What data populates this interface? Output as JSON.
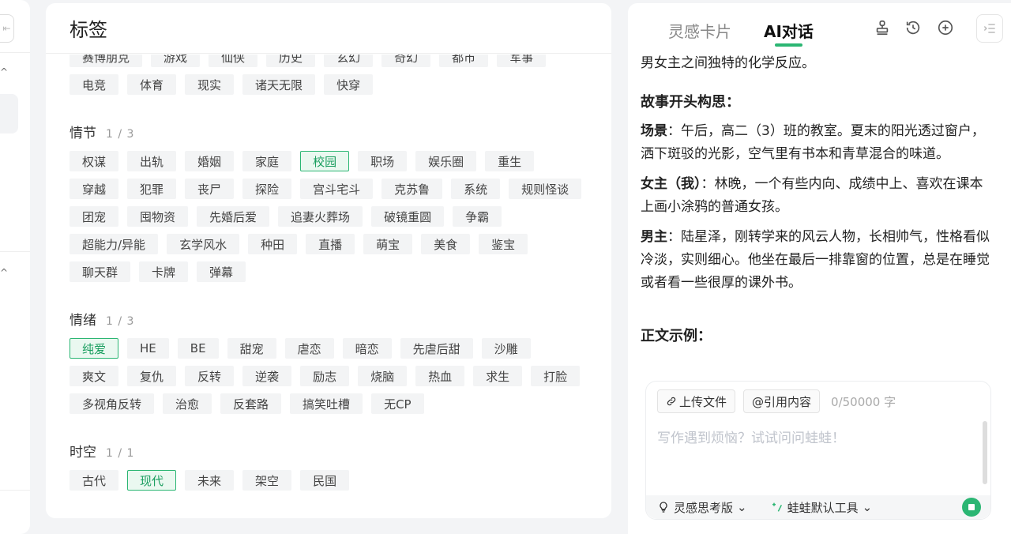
{
  "tag_panel": {
    "title": "标签",
    "sections": [
      {
        "tags": [
          "赛博朋克",
          "游戏",
          "仙侠",
          "历史",
          "玄幻",
          "奇幻",
          "都市",
          "军事",
          "电竞",
          "体育",
          "现实",
          "诸天无限",
          "快穿"
        ],
        "selected": []
      },
      {
        "title": "情节",
        "count": "1 / 3",
        "tags": [
          "权谋",
          "出轨",
          "婚姻",
          "家庭",
          "校园",
          "职场",
          "娱乐圈",
          "重生",
          "穿越",
          "犯罪",
          "丧尸",
          "探险",
          "宫斗宅斗",
          "克苏鲁",
          "系统",
          "规则怪谈",
          "团宠",
          "囤物资",
          "先婚后爱",
          "追妻火葬场",
          "破镜重圆",
          "争霸",
          "超能力/异能",
          "玄学风水",
          "种田",
          "直播",
          "萌宝",
          "美食",
          "鉴宝",
          "聊天群",
          "卡牌",
          "弹幕"
        ],
        "selected": [
          "校园"
        ]
      },
      {
        "title": "情绪",
        "count": "1 / 3",
        "tags": [
          "纯爱",
          "HE",
          "BE",
          "甜宠",
          "虐恋",
          "暗恋",
          "先虐后甜",
          "沙雕",
          "爽文",
          "复仇",
          "反转",
          "逆袭",
          "励志",
          "烧脑",
          "热血",
          "求生",
          "打脸",
          "多视角反转",
          "治愈",
          "反套路",
          "搞笑吐槽",
          "无CP"
        ],
        "selected": [
          "纯爱"
        ]
      },
      {
        "title": "时空",
        "count": "1 / 1",
        "tags": [
          "古代",
          "现代",
          "未来",
          "架空",
          "民国"
        ],
        "selected": [
          "现代"
        ]
      }
    ]
  },
  "chat_panel": {
    "tabs": [
      {
        "label": "灵感卡片",
        "active": false
      },
      {
        "label": "AI对话",
        "active": true
      }
    ],
    "header_icons": [
      "stamp-icon",
      "history-icon",
      "add-circle-icon",
      "collapse-panel-icon"
    ],
    "messages": {
      "intro": "男女主之间独特的化学反应。",
      "opening_heading": "故事开头构思：",
      "scene_label": "场景",
      "scene_text": "：午后，高二（3）班的教室。夏末的阳光透过窗户，洒下斑驳的光影，空气里有书本和青草混合的味道。",
      "heroine_label": "女主（我）",
      "heroine_text": "：林晚，一个有些内向、成绩中上、喜欢在课本上画小涂鸦的普通女孩。",
      "hero_label": "男主",
      "hero_text": "：陆星泽，刚转学来的风云人物，长相帅气，性格看似冷淡，实则细心。他坐在最后一排靠窗的位置，总是在睡觉或者看一些很厚的课外书。",
      "example_heading": "正文示例："
    },
    "input": {
      "upload_label": "上传文件",
      "quote_label": "@引用内容",
      "char_count": "0/50000 字",
      "placeholder": "写作遇到烦恼？试试问问蛙蛙！",
      "value": "",
      "model_label": "灵感思考版",
      "tools_label": "蛙蛙默认工具"
    }
  },
  "colors": {
    "accent": "#2bb673",
    "selected_bg": "#eaf8f0",
    "tag_bg": "#f3f4f5",
    "page_bg": "#f3f4f6"
  }
}
